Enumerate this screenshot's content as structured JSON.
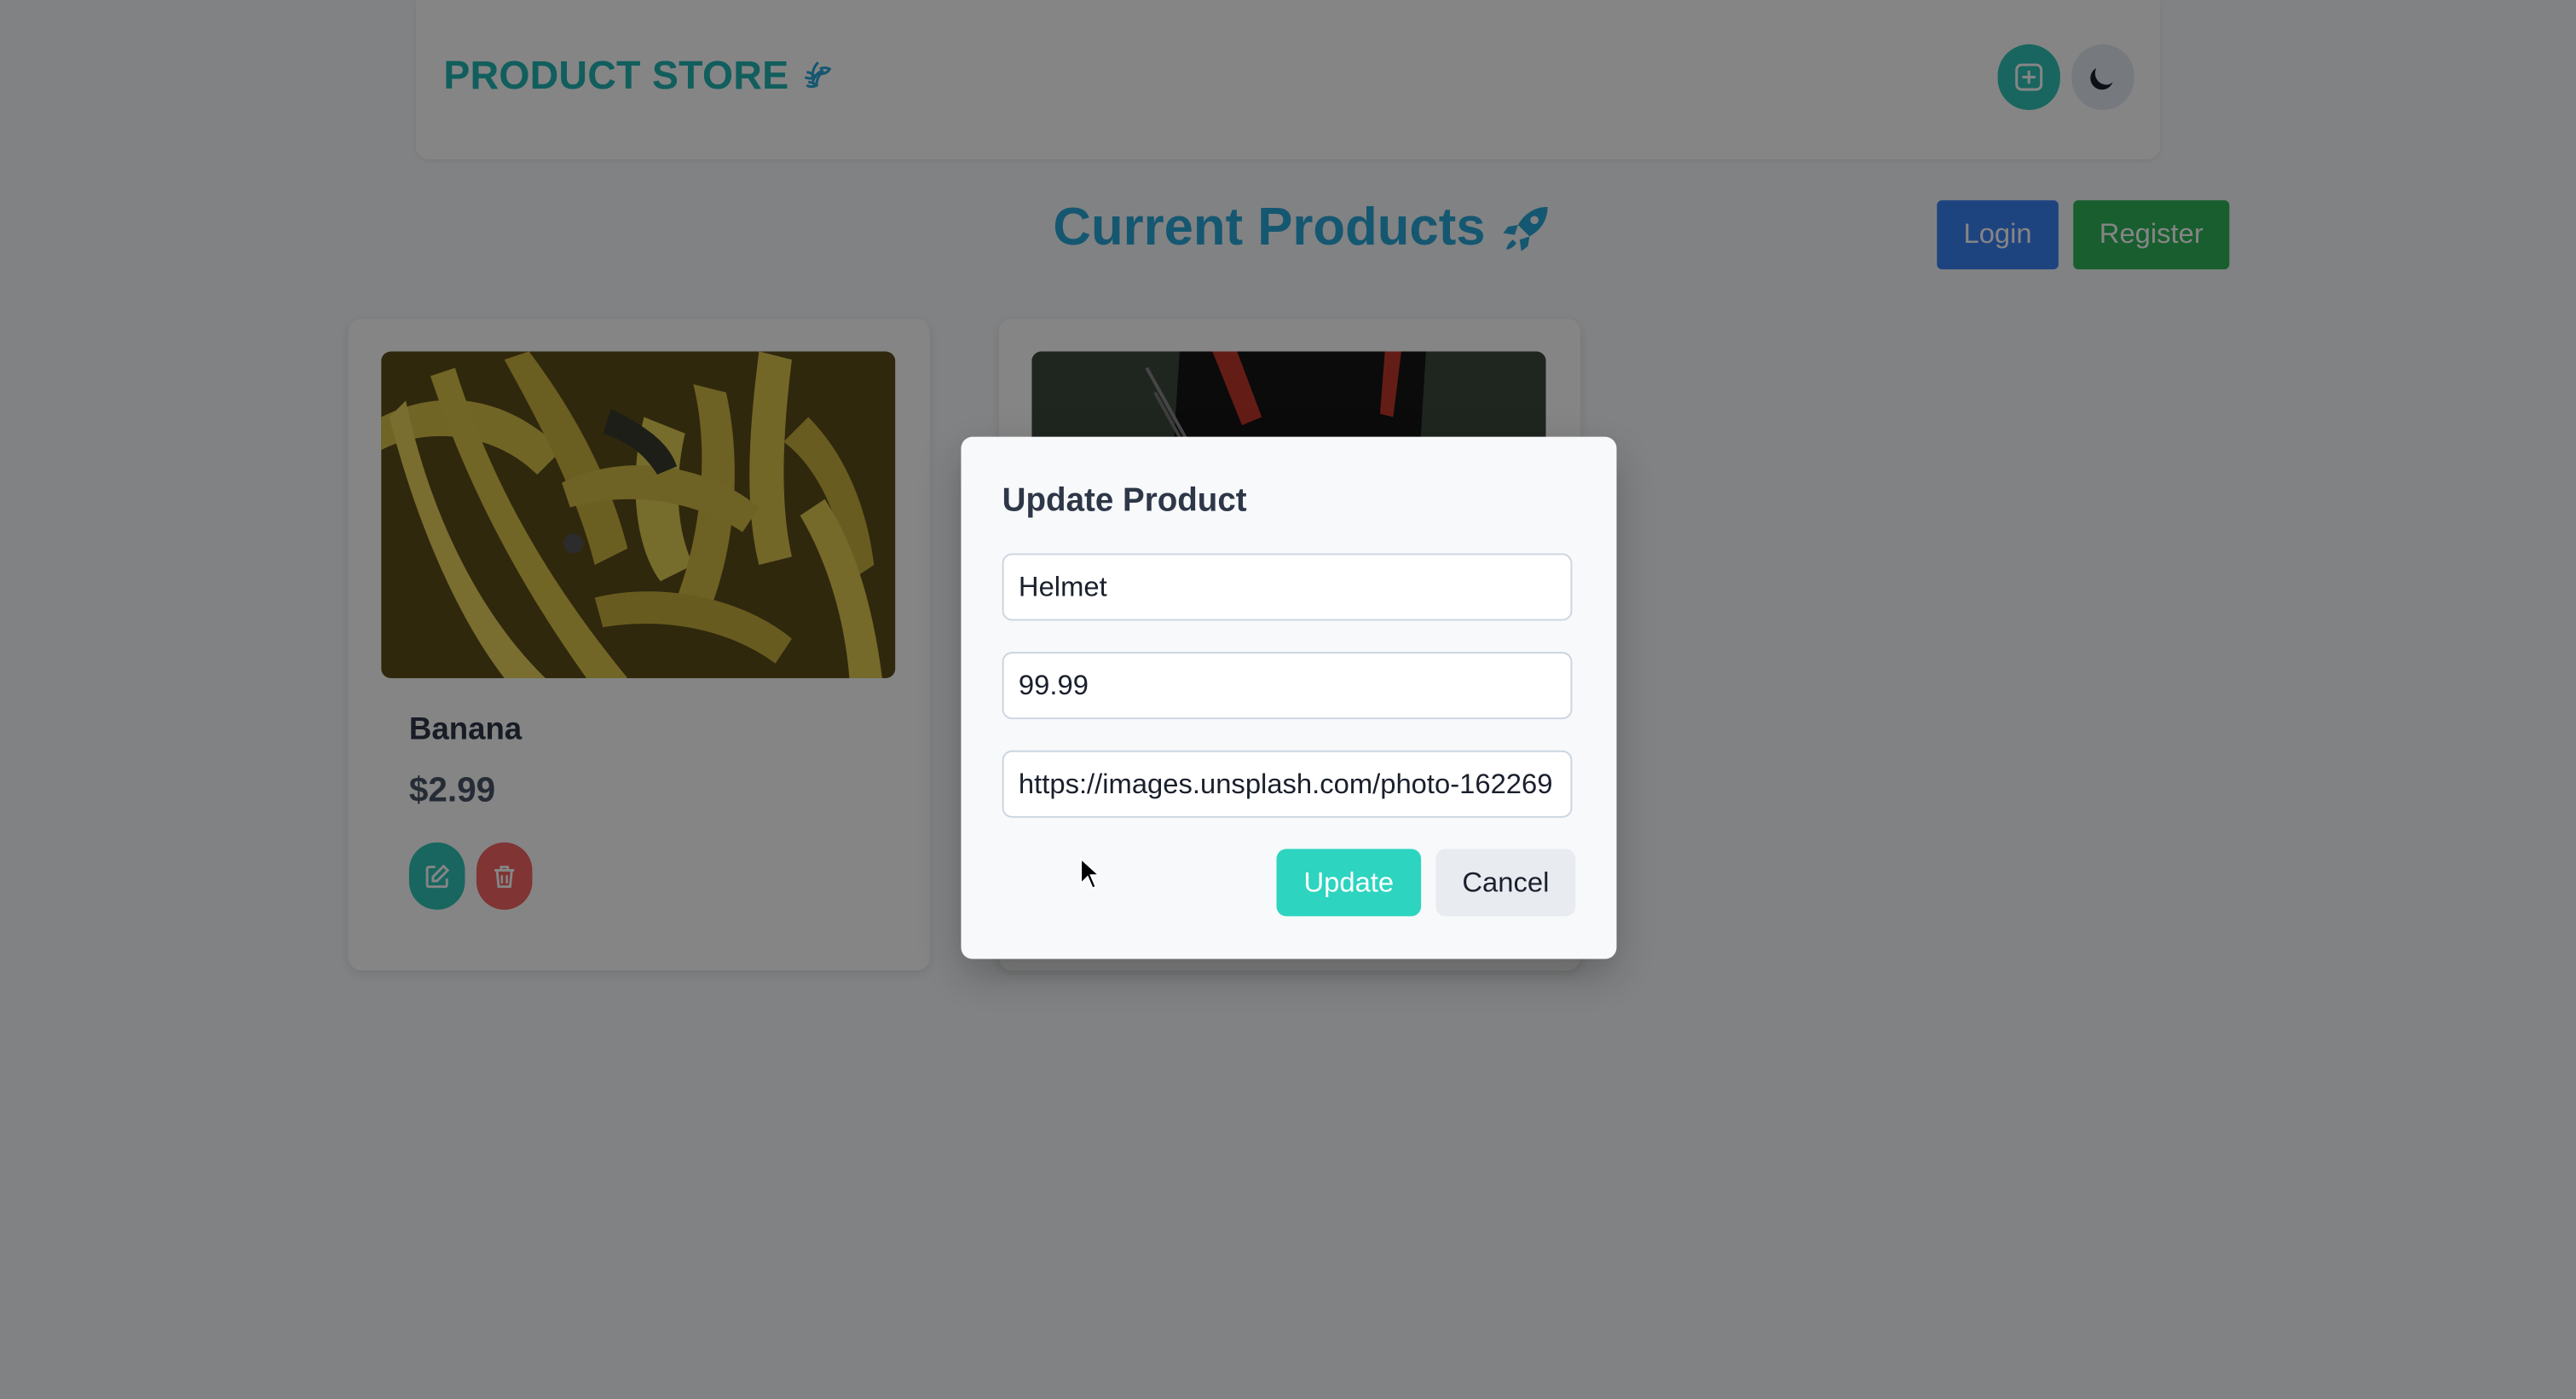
{
  "navbar": {
    "brand": "PRODUCT STORE",
    "brand_icon": "leaf-icon",
    "create_icon": "plus-square-icon",
    "theme_icon": "moon-icon"
  },
  "header": {
    "title": "Current Products",
    "title_icon": "rocket-icon",
    "login_label": "Login",
    "register_label": "Register"
  },
  "products": [
    {
      "name": "Banana",
      "price": "$2.99",
      "image": "banana-photo"
    },
    {
      "name": "",
      "price": "",
      "image": "helmet-photo"
    }
  ],
  "modal": {
    "title": "Update Product",
    "name_value": "Helmet",
    "price_value": "99.99",
    "image_value": "https://images.unsplash.com/photo-162269",
    "update_label": "Update",
    "cancel_label": "Cancel"
  },
  "colors": {
    "accent": "#2ec4b6",
    "title_blue": "#2aa8d8",
    "login": "#3b82f6",
    "register": "#2fb55a",
    "delete": "#f56565"
  }
}
